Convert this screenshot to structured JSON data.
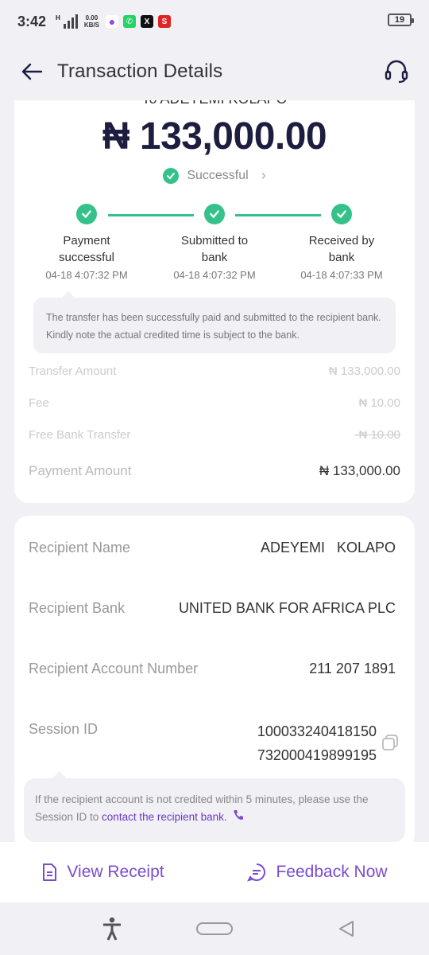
{
  "status_bar": {
    "time": "3:42",
    "network_speed_value": "0.00",
    "network_speed_unit": "KB/S",
    "network_type": "H",
    "battery": "19",
    "apps": [
      {
        "icon": "messenger-icon",
        "color": "#8e44ef"
      },
      {
        "icon": "whatsapp-icon",
        "color": "#25d366"
      },
      {
        "icon": "x-icon",
        "color": "#111111"
      },
      {
        "icon": "s-app-icon",
        "color": "#e02424"
      }
    ]
  },
  "header": {
    "title": "Transaction Details",
    "back_icon": "arrow-left-icon",
    "support_icon": "headset-icon"
  },
  "summary": {
    "recipient_line": "To ADEYEMI KOLAPO",
    "amount": "₦ 133,000.00",
    "status": "Successful"
  },
  "steps": [
    {
      "label_line1": "Payment",
      "label_line2": "successful",
      "time": "04-18 4:07:32 PM"
    },
    {
      "label_line1": "Submitted to",
      "label_line2": "bank",
      "time": "04-18 4:07:32 PM"
    },
    {
      "label_line1": "Received by",
      "label_line2": "bank",
      "time": "04-18 4:07:33 PM"
    }
  ],
  "info_note": "The transfer has been successfully paid and submitted to the recipient bank. Kindly note the actual credited time is subject to the bank.",
  "fees": {
    "transfer_amount_label": "Transfer Amount",
    "transfer_amount_value": "₦ 133,000.00",
    "fee_label": "Fee",
    "fee_value": "₦ 10.00",
    "free_transfer_label": "Free Bank Transfer",
    "free_transfer_value": "-₦ 10.00",
    "payment_amount_label": "Payment Amount",
    "payment_amount_value": "₦ 133,000.00"
  },
  "recipient": {
    "name_label": "Recipient Name",
    "name_value": "ADEYEMI   KOLAPO",
    "bank_label": "Recipient Bank",
    "bank_value": "UNITED BANK FOR AFRICA PLC",
    "account_label": "Recipient Account Number",
    "account_value": "211 207 1891",
    "session_label": "Session ID",
    "session_value_line1": "100033240418150",
    "session_value_line2": "732000419899195"
  },
  "session_note": {
    "text": "If the recipient account is not credited within 5 minutes, please use the Session ID to ",
    "link": "contact the recipient bank."
  },
  "actions": {
    "view_receipt": "View Receipt",
    "feedback": "Feedback Now"
  },
  "colors": {
    "accent": "#7a4bd1",
    "success": "#34c28a",
    "amount": "#1d1d3f"
  }
}
